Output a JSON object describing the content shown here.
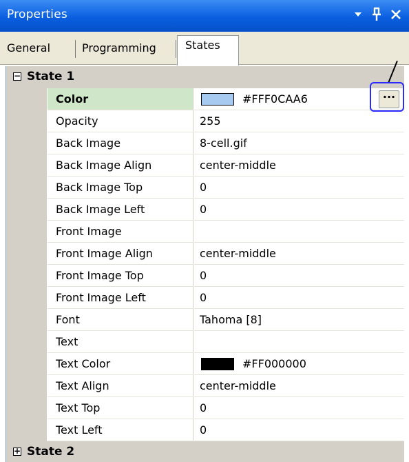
{
  "titlebar": {
    "title": "Properties",
    "dropdown_glyph": "▾",
    "pin_glyph": "ᵖ",
    "close_glyph": "✕"
  },
  "tabs": [
    {
      "label": "General"
    },
    {
      "label": "Programming"
    },
    {
      "label": "States",
      "active": true
    }
  ],
  "grid": {
    "categories": [
      {
        "label": "State 1",
        "expander": "⊟",
        "expanded": true
      },
      {
        "label": "State 2",
        "expander": "⊞",
        "expanded": false
      }
    ],
    "rows": [
      {
        "name": "Color",
        "value": "#FFF0CAA6",
        "swatch": "#a6caf0",
        "selected": true,
        "button": "···"
      },
      {
        "name": "Opacity",
        "value": "255"
      },
      {
        "name": "Back Image",
        "value": "8-cell.gif"
      },
      {
        "name": "Back Image Align",
        "value": "center-middle"
      },
      {
        "name": "Back Image Top",
        "value": "0"
      },
      {
        "name": "Back Image Left",
        "value": "0"
      },
      {
        "name": "Front Image",
        "value": ""
      },
      {
        "name": "Front Image Align",
        "value": "center-middle"
      },
      {
        "name": "Front Image Top",
        "value": "0"
      },
      {
        "name": "Front Image Left",
        "value": "0"
      },
      {
        "name": "Font",
        "value": "Tahoma [8]"
      },
      {
        "name": "Text",
        "value": ""
      },
      {
        "name": "Text Color",
        "value": "#FF000000",
        "swatch": "#000000"
      },
      {
        "name": "Text Align",
        "value": "center-middle"
      },
      {
        "name": "Text Top",
        "value": "0"
      },
      {
        "name": "Text Left",
        "value": "0"
      }
    ]
  },
  "colors": {
    "titlebar": "#0a5fe0",
    "selected_name_bg": "#cfe6c8",
    "highlight": "#2a2aff"
  }
}
